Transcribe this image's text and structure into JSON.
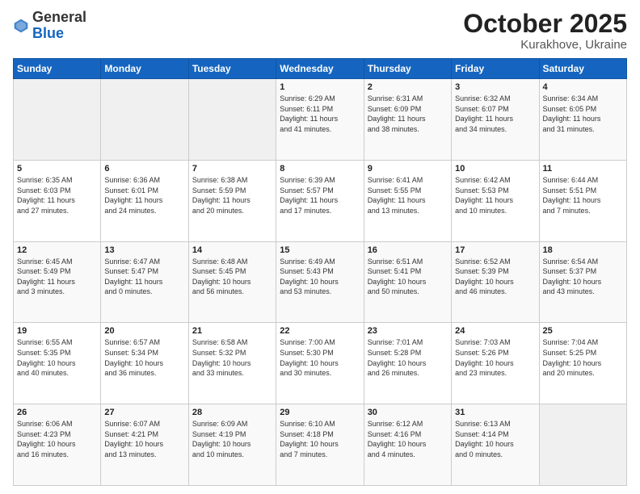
{
  "header": {
    "logo_general": "General",
    "logo_blue": "Blue",
    "month_title": "October 2025",
    "location": "Kurakhove, Ukraine"
  },
  "days_of_week": [
    "Sunday",
    "Monday",
    "Tuesday",
    "Wednesday",
    "Thursday",
    "Friday",
    "Saturday"
  ],
  "weeks": [
    {
      "cells": [
        {
          "day": "",
          "info": ""
        },
        {
          "day": "",
          "info": ""
        },
        {
          "day": "",
          "info": ""
        },
        {
          "day": "1",
          "info": "Sunrise: 6:29 AM\nSunset: 6:11 PM\nDaylight: 11 hours\nand 41 minutes."
        },
        {
          "day": "2",
          "info": "Sunrise: 6:31 AM\nSunset: 6:09 PM\nDaylight: 11 hours\nand 38 minutes."
        },
        {
          "day": "3",
          "info": "Sunrise: 6:32 AM\nSunset: 6:07 PM\nDaylight: 11 hours\nand 34 minutes."
        },
        {
          "day": "4",
          "info": "Sunrise: 6:34 AM\nSunset: 6:05 PM\nDaylight: 11 hours\nand 31 minutes."
        }
      ]
    },
    {
      "cells": [
        {
          "day": "5",
          "info": "Sunrise: 6:35 AM\nSunset: 6:03 PM\nDaylight: 11 hours\nand 27 minutes."
        },
        {
          "day": "6",
          "info": "Sunrise: 6:36 AM\nSunset: 6:01 PM\nDaylight: 11 hours\nand 24 minutes."
        },
        {
          "day": "7",
          "info": "Sunrise: 6:38 AM\nSunset: 5:59 PM\nDaylight: 11 hours\nand 20 minutes."
        },
        {
          "day": "8",
          "info": "Sunrise: 6:39 AM\nSunset: 5:57 PM\nDaylight: 11 hours\nand 17 minutes."
        },
        {
          "day": "9",
          "info": "Sunrise: 6:41 AM\nSunset: 5:55 PM\nDaylight: 11 hours\nand 13 minutes."
        },
        {
          "day": "10",
          "info": "Sunrise: 6:42 AM\nSunset: 5:53 PM\nDaylight: 11 hours\nand 10 minutes."
        },
        {
          "day": "11",
          "info": "Sunrise: 6:44 AM\nSunset: 5:51 PM\nDaylight: 11 hours\nand 7 minutes."
        }
      ]
    },
    {
      "cells": [
        {
          "day": "12",
          "info": "Sunrise: 6:45 AM\nSunset: 5:49 PM\nDaylight: 11 hours\nand 3 minutes."
        },
        {
          "day": "13",
          "info": "Sunrise: 6:47 AM\nSunset: 5:47 PM\nDaylight: 11 hours\nand 0 minutes."
        },
        {
          "day": "14",
          "info": "Sunrise: 6:48 AM\nSunset: 5:45 PM\nDaylight: 10 hours\nand 56 minutes."
        },
        {
          "day": "15",
          "info": "Sunrise: 6:49 AM\nSunset: 5:43 PM\nDaylight: 10 hours\nand 53 minutes."
        },
        {
          "day": "16",
          "info": "Sunrise: 6:51 AM\nSunset: 5:41 PM\nDaylight: 10 hours\nand 50 minutes."
        },
        {
          "day": "17",
          "info": "Sunrise: 6:52 AM\nSunset: 5:39 PM\nDaylight: 10 hours\nand 46 minutes."
        },
        {
          "day": "18",
          "info": "Sunrise: 6:54 AM\nSunset: 5:37 PM\nDaylight: 10 hours\nand 43 minutes."
        }
      ]
    },
    {
      "cells": [
        {
          "day": "19",
          "info": "Sunrise: 6:55 AM\nSunset: 5:35 PM\nDaylight: 10 hours\nand 40 minutes."
        },
        {
          "day": "20",
          "info": "Sunrise: 6:57 AM\nSunset: 5:34 PM\nDaylight: 10 hours\nand 36 minutes."
        },
        {
          "day": "21",
          "info": "Sunrise: 6:58 AM\nSunset: 5:32 PM\nDaylight: 10 hours\nand 33 minutes."
        },
        {
          "day": "22",
          "info": "Sunrise: 7:00 AM\nSunset: 5:30 PM\nDaylight: 10 hours\nand 30 minutes."
        },
        {
          "day": "23",
          "info": "Sunrise: 7:01 AM\nSunset: 5:28 PM\nDaylight: 10 hours\nand 26 minutes."
        },
        {
          "day": "24",
          "info": "Sunrise: 7:03 AM\nSunset: 5:26 PM\nDaylight: 10 hours\nand 23 minutes."
        },
        {
          "day": "25",
          "info": "Sunrise: 7:04 AM\nSunset: 5:25 PM\nDaylight: 10 hours\nand 20 minutes."
        }
      ]
    },
    {
      "cells": [
        {
          "day": "26",
          "info": "Sunrise: 6:06 AM\nSunset: 4:23 PM\nDaylight: 10 hours\nand 16 minutes."
        },
        {
          "day": "27",
          "info": "Sunrise: 6:07 AM\nSunset: 4:21 PM\nDaylight: 10 hours\nand 13 minutes."
        },
        {
          "day": "28",
          "info": "Sunrise: 6:09 AM\nSunset: 4:19 PM\nDaylight: 10 hours\nand 10 minutes."
        },
        {
          "day": "29",
          "info": "Sunrise: 6:10 AM\nSunset: 4:18 PM\nDaylight: 10 hours\nand 7 minutes."
        },
        {
          "day": "30",
          "info": "Sunrise: 6:12 AM\nSunset: 4:16 PM\nDaylight: 10 hours\nand 4 minutes."
        },
        {
          "day": "31",
          "info": "Sunrise: 6:13 AM\nSunset: 4:14 PM\nDaylight: 10 hours\nand 0 minutes."
        },
        {
          "day": "",
          "info": ""
        }
      ]
    }
  ]
}
